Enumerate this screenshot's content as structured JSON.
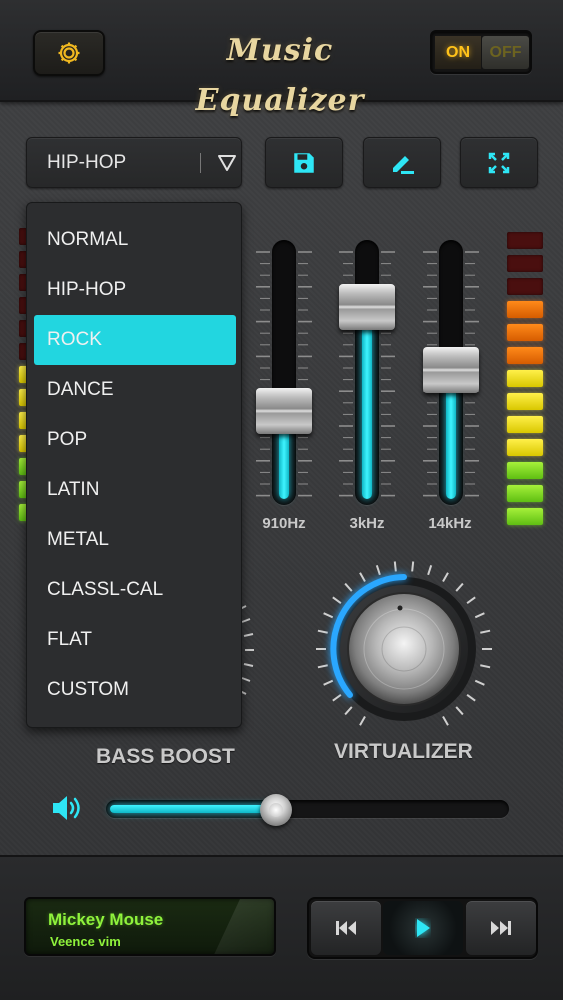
{
  "header": {
    "title": "Music Equalizer",
    "power": {
      "on_label": "ON",
      "off_label": "OFF",
      "state": "on"
    },
    "settings_icon": "gear-icon"
  },
  "preset": {
    "selected": "HIP-HOP",
    "options": [
      "NORMAL",
      "HIP-HOP",
      "ROCK",
      "DANCE",
      "POP",
      "LATIN",
      "METAL",
      "CLASSL-CAL",
      "FLAT",
      "CUSTOM"
    ],
    "highlighted": "ROCK"
  },
  "toolbar": {
    "save_icon": "save-icon",
    "edit_icon": "edit-icon",
    "fullscreen_icon": "fullscreen-icon"
  },
  "bands": [
    {
      "label": "910Hz",
      "level": 0.3
    },
    {
      "label": "3kHz",
      "level": 0.8
    },
    {
      "label": "14kHz",
      "level": 0.5
    }
  ],
  "knobs": {
    "bass_label": "BASS BOOST",
    "virtualizer_label": "VIRTUALIZER",
    "virtualizer_level": 0.28
  },
  "volume": {
    "level": 0.42,
    "icon": "speaker-icon"
  },
  "now_playing": {
    "title": "Mickey Mouse",
    "artist": "Veence vim"
  },
  "player": {
    "prev_icon": "previous-icon",
    "play_icon": "play-icon",
    "next_icon": "next-icon"
  },
  "colors": {
    "accent": "#2ee6f5",
    "highlight": "#22d6e0",
    "title": "#e8d6a0",
    "lcd_text": "#8ff23c"
  }
}
